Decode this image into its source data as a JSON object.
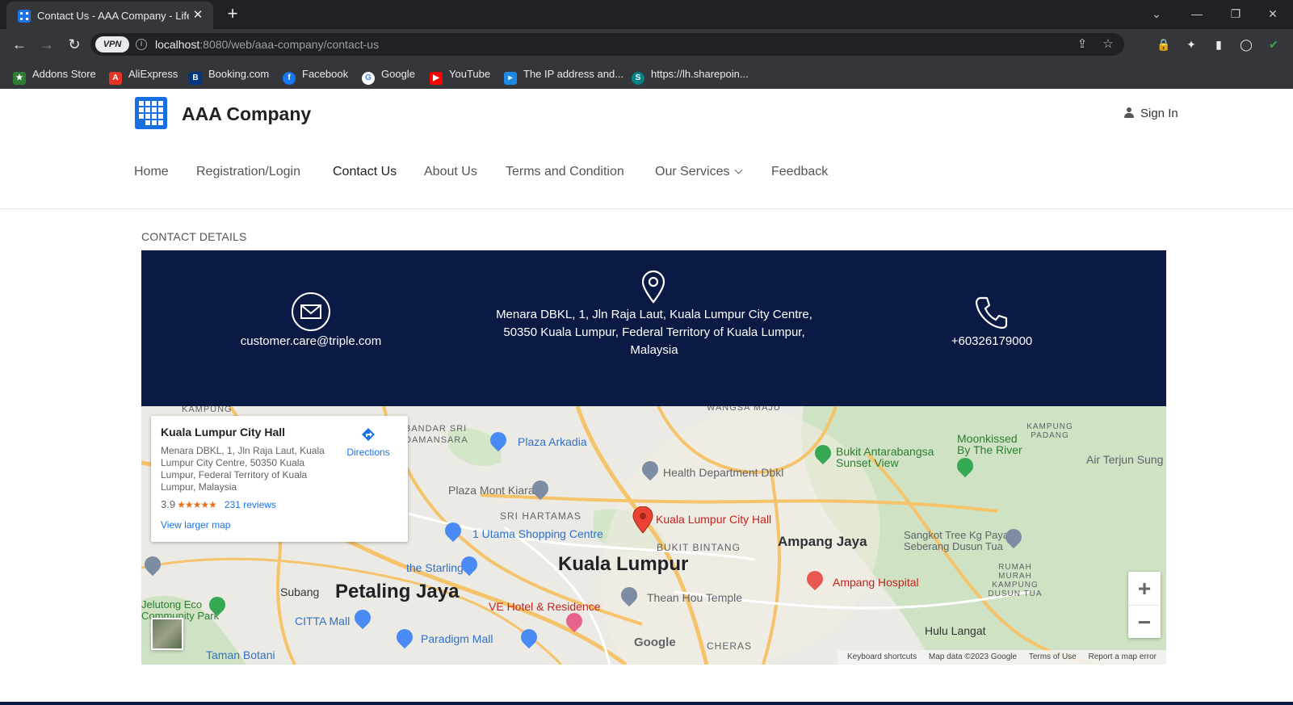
{
  "browser": {
    "tab_title": "Contact Us - AAA Company - Life",
    "url_host": "localhost",
    "url_path": ":8080/web/aaa-company/contact-us",
    "vpn_label": "VPN",
    "bookmarks": [
      {
        "label": "Addons Store",
        "color": "#2e7d32"
      },
      {
        "label": "AliExpress",
        "color": "#e43225"
      },
      {
        "label": "Booking.com",
        "color": "#003580"
      },
      {
        "label": "Facebook",
        "color": "#1877f2"
      },
      {
        "label": "Google",
        "color": "#ffffff"
      },
      {
        "label": "YouTube",
        "color": "#ff0000"
      },
      {
        "label": "The IP address and...",
        "color": "#1e88e5"
      },
      {
        "label": "https://lh.sharepoin...",
        "color": "#038387"
      }
    ]
  },
  "header": {
    "brand": "AAA Company",
    "sign_in": "Sign In"
  },
  "nav": {
    "items": [
      {
        "label": "Home"
      },
      {
        "label": "Registration/Login"
      },
      {
        "label": "Contact Us"
      },
      {
        "label": "About Us"
      },
      {
        "label": "Terms and Condition"
      },
      {
        "label": "Our Services"
      },
      {
        "label": "Feedback"
      }
    ],
    "active": "Contact Us"
  },
  "contact": {
    "section_title": "CONTACT DETAILS",
    "email": "customer.care@triple.com",
    "address_line1": "Menara DBKL, 1, Jln Raja Laut, Kuala Lumpur City Centre,",
    "address_line2": "50350 Kuala Lumpur, Federal Territory of Kuala Lumpur,",
    "address_line3": "Malaysia",
    "phone": "+60326179000",
    "band_color": "#0b1a44"
  },
  "map": {
    "card": {
      "name": "Kuala Lumpur City Hall",
      "address": "Menara DBKL, 1, Jln Raja Laut, Kuala Lumpur City Centre, 50350 Kuala Lumpur, Federal Territory of Kuala Lumpur, Malaysia",
      "rating": "3.9",
      "stars": "★★★★★",
      "reviews": "231 reviews",
      "larger_map": "View larger map",
      "directions": "Directions"
    },
    "labels": {
      "kuala_lumpur": "Kuala Lumpur",
      "petaling_jaya": "Petaling Jaya",
      "ampang_jaya": "Ampang Jaya",
      "city_hall": "Kuala Lumpur City Hall",
      "plaza_arkadia": "Plaza Arkadia",
      "health_dept": "Health Department Dbkl",
      "plaza_mont_kiara": "Plaza Mont Kiara",
      "sri_hartamas": "SRI HARTAMAS",
      "utama": "1 Utama Shopping Centre",
      "bukit_bintang": "BUKIT BINTANG",
      "the_starling": "the Starling",
      "subang": "Subang",
      "citta_mall": "CITTA Mall",
      "jelutong": "Jelutong Eco",
      "community_park": "Community Park",
      "ve_hotel": "VE Hotel & Residence",
      "paradigm_mall": "Paradigm Mall",
      "thean_hou": "Thean Hou Temple",
      "cheras": "CHERAS",
      "ampang_hospital": "Ampang Hospital",
      "bukit_antara": "Bukit Antarabangsa",
      "sunset_view": "Sunset View",
      "moonkissed": "Moonkissed",
      "by_the_river": "By The River",
      "air_terjun": "Air Terjun Sung",
      "sangkot": "Sangkot Tree Kg Paya",
      "seberang": "Seberang Dusun Tua",
      "hulu_langat": "Hulu Langat",
      "bandar_sri": "BANDAR SRI",
      "damansara": "DAMANSARA",
      "wangsa_maju": "WANGSA MAJU",
      "kampung_padang": "KAMPUNG PADANG",
      "taman_botani": "Taman Botani",
      "rumah_murah": "RUMAH MURAH KAMPUNG DUSUN TUA"
    },
    "attribution": {
      "shortcuts": "Keyboard shortcuts",
      "data": "Map data ©2023 Google",
      "terms": "Terms of Use",
      "report": "Report a map error"
    },
    "google": "Google"
  }
}
